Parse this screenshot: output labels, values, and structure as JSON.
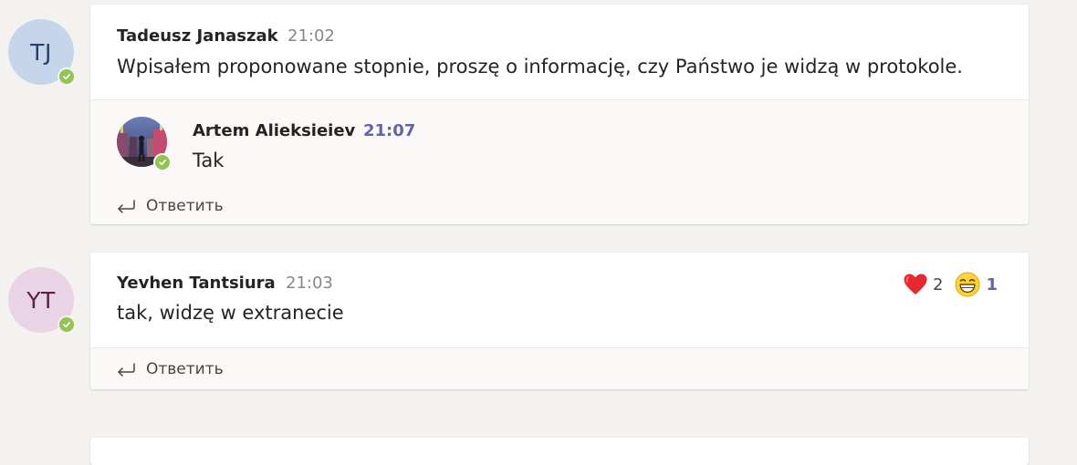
{
  "colors": {
    "background": "#f3f2f1",
    "card": "#ffffff",
    "reply_bg": "#faf9f8",
    "accent": "#6264a7",
    "presence_available": "#92c353"
  },
  "messages": [
    {
      "initials": "TJ",
      "author": "Tadeusz Janaszak",
      "time": "21:02",
      "text": "Wpisałem proponowane stopnie, proszę o informację, czy Państwo je widzą w protokole.",
      "presence": "available",
      "replies": [
        {
          "author": "Artem Alieksieiev",
          "time": "21:07",
          "text": "Tak",
          "avatar": "photo",
          "presence": "available"
        }
      ],
      "reply_label": "Ответить"
    },
    {
      "initials": "YT",
      "author": "Yevhen Tantsiura",
      "time": "21:03",
      "text": "tak, widzę w extranecie",
      "presence": "available",
      "reactions": [
        {
          "icon": "heart-icon",
          "count": "2",
          "mine": false
        },
        {
          "icon": "laugh-emoji-icon",
          "count": "1",
          "mine": true
        }
      ],
      "reply_label": "Ответить"
    }
  ]
}
